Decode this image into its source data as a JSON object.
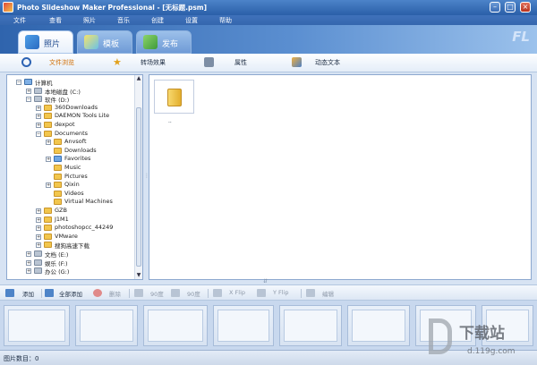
{
  "window": {
    "title": "Photo Slideshow Maker Professional - [无标题.psm]"
  },
  "menu": [
    "文件",
    "查看",
    "照片",
    "音乐",
    "创建",
    "设置",
    "帮助"
  ],
  "tabs": [
    {
      "label": "照片",
      "icon": "photo-icon",
      "active": true
    },
    {
      "label": "模板",
      "icon": "template-icon",
      "active": false
    },
    {
      "label": "发布",
      "icon": "publish-icon",
      "active": false
    }
  ],
  "banner_deco": "FL",
  "subtabs": [
    {
      "label": "文件浏览",
      "icon": "magnifier-icon",
      "active": true
    },
    {
      "label": "转场效果",
      "icon": "transition-icon",
      "active": false
    },
    {
      "label": "属性",
      "icon": "properties-icon",
      "active": false
    },
    {
      "label": "动态文本",
      "icon": "text-effect-icon",
      "active": false
    }
  ],
  "tree": [
    {
      "label": "计算机",
      "level": 0,
      "expander": "−",
      "kind": "pc"
    },
    {
      "label": "本地磁盘 (C:)",
      "level": 1,
      "expander": "+",
      "kind": "drive"
    },
    {
      "label": "软件 (D:)",
      "level": 1,
      "expander": "−",
      "kind": "drive"
    },
    {
      "label": "360Downloads",
      "level": 2,
      "expander": "+",
      "kind": "folder"
    },
    {
      "label": "DAEMON Tools Lite",
      "level": 2,
      "expander": "+",
      "kind": "folder"
    },
    {
      "label": "dexpot",
      "level": 2,
      "expander": "+",
      "kind": "folder"
    },
    {
      "label": "Documents",
      "level": 2,
      "expander": "−",
      "kind": "folder"
    },
    {
      "label": "Anvsoft",
      "level": 3,
      "expander": "+",
      "kind": "folder"
    },
    {
      "label": "Downloads",
      "level": 3,
      "expander": "",
      "kind": "folder"
    },
    {
      "label": "Favorites",
      "level": 3,
      "expander": "+",
      "kind": "special"
    },
    {
      "label": "Music",
      "level": 3,
      "expander": "",
      "kind": "folder"
    },
    {
      "label": "Pictures",
      "level": 3,
      "expander": "",
      "kind": "folder"
    },
    {
      "label": "Qixin",
      "level": 3,
      "expander": "+",
      "kind": "folder"
    },
    {
      "label": "Videos",
      "level": 3,
      "expander": "",
      "kind": "folder"
    },
    {
      "label": "Virtual Machines",
      "level": 3,
      "expander": "",
      "kind": "folder"
    },
    {
      "label": "GZB",
      "level": 2,
      "expander": "+",
      "kind": "folder"
    },
    {
      "label": "J1M1",
      "level": 2,
      "expander": "+",
      "kind": "folder"
    },
    {
      "label": "photoshopcc_44249",
      "level": 2,
      "expander": "+",
      "kind": "folder"
    },
    {
      "label": "VMware",
      "level": 2,
      "expander": "+",
      "kind": "folder"
    },
    {
      "label": "搜狗高速下载",
      "level": 2,
      "expander": "+",
      "kind": "folder"
    },
    {
      "label": "文档 (E:)",
      "level": 1,
      "expander": "+",
      "kind": "drive"
    },
    {
      "label": "娱乐 (F:)",
      "level": 1,
      "expander": "+",
      "kind": "drive"
    },
    {
      "label": "办公 (G:)",
      "level": 1,
      "expander": "+",
      "kind": "drive"
    }
  ],
  "files": [
    {
      "caption": "..",
      "kind": "parent-folder"
    }
  ],
  "toolbar": {
    "add": "添加",
    "add_all": "全部添加",
    "delete": "删除",
    "rot_left": "90度",
    "rot_right": "90度",
    "xflip": "X Flip",
    "yflip": "Y Flip",
    "edit": "编辑"
  },
  "storyboard_frames": 8,
  "status": {
    "text": "图片数目：0"
  },
  "watermark": {
    "brand": "下载站",
    "url": "d.119g.com"
  },
  "colors": {
    "accent": "#2f64ad",
    "active_subtab": "#d06c00",
    "folder": "#f2c64d"
  }
}
